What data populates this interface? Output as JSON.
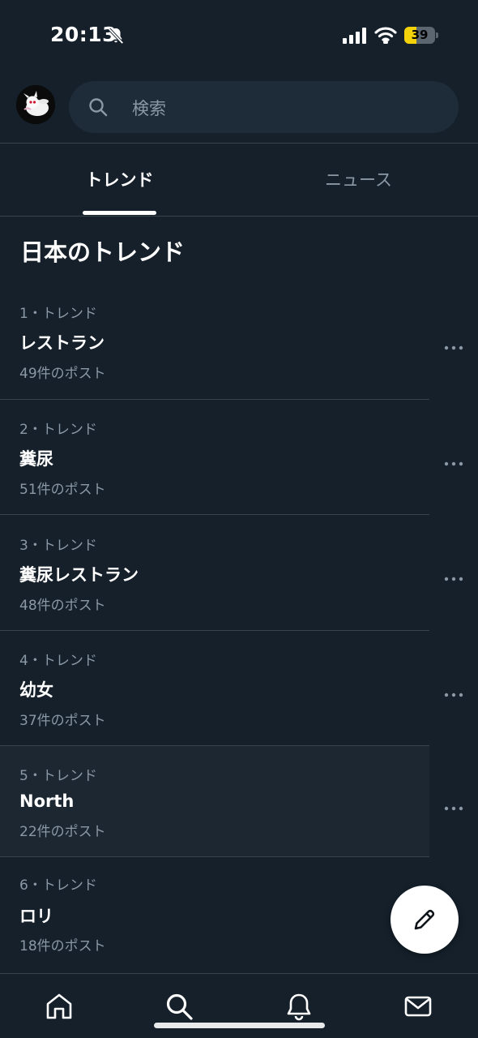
{
  "status_bar": {
    "time": "20:13",
    "battery_level": "39",
    "battery_fraction": 0.39,
    "icons": [
      "bell-slash-icon",
      "cellular-signal-icon",
      "wifi-icon",
      "battery-icon"
    ]
  },
  "search": {
    "placeholder": "検索",
    "icon": "search-icon"
  },
  "tabs": [
    {
      "label": "トレンド",
      "active": true
    },
    {
      "label": "ニュース",
      "active": false
    }
  ],
  "section_title": "日本のトレンド",
  "trends": [
    {
      "meta": "1・トレンド",
      "name": "レストラン",
      "count": "49件のポスト"
    },
    {
      "meta": "2・トレンド",
      "name": "糞尿",
      "count": "51件のポスト"
    },
    {
      "meta": "3・トレンド",
      "name": "糞尿レストラン",
      "count": "48件のポスト"
    },
    {
      "meta": "4・トレンド",
      "name": "幼女",
      "count": "37件のポスト"
    },
    {
      "meta": "5・トレンド",
      "name": "North",
      "count": "22件のポスト"
    },
    {
      "meta": "6・トレンド",
      "name": "ロリ",
      "count": "18件のポスト"
    }
  ],
  "fab_icon": "compose-pencil-icon",
  "bottom_nav": [
    "home-icon",
    "search-icon",
    "bell-icon",
    "mail-icon"
  ],
  "colors": {
    "background": "#15202b",
    "search_bg": "#1e2c39",
    "secondary_text": "#8b98a5",
    "divider": "#38444d",
    "battery": "#f4d20a",
    "highlight_row": "#1c2731"
  }
}
